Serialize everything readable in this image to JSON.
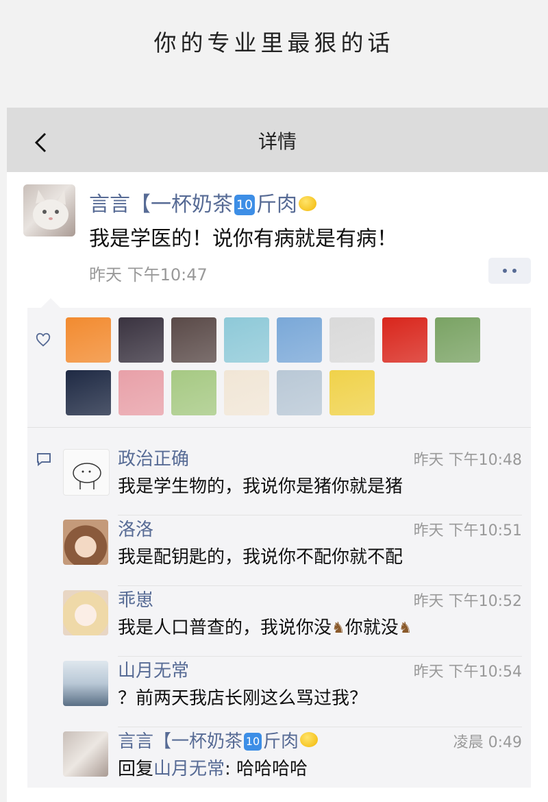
{
  "caption": "你的专业里最狠的话",
  "nav": {
    "title": "详情"
  },
  "post": {
    "author": {
      "name_prefix": "言言【一杯奶茶",
      "badge": "10",
      "name_suffix": "斤肉"
    },
    "text": "我是学医的！说你有病就是有病！",
    "time": "昨天 下午10:47"
  },
  "likes": {
    "avatars": [
      {
        "name": "pumpkin",
        "color": "#f28b30"
      },
      {
        "name": "dark-hair",
        "color": "#3a3340"
      },
      {
        "name": "mask-girl",
        "color": "#5a4a48"
      },
      {
        "name": "blue-hair",
        "color": "#8ec9d8"
      },
      {
        "name": "anime-boy",
        "color": "#7aa8d8"
      },
      {
        "name": "sketch",
        "color": "#d9d9d9"
      },
      {
        "name": "china-flag",
        "color": "#d9261c"
      },
      {
        "name": "anime-girl",
        "color": "#7aa364"
      },
      {
        "name": "suit",
        "color": "#1f2a44"
      },
      {
        "name": "cartoon-pink",
        "color": "#e8a0a8"
      },
      {
        "name": "clover-girl",
        "color": "#a6c983"
      },
      {
        "name": "blonde-anime",
        "color": "#f1e6d6"
      },
      {
        "name": "outdoor-girl",
        "color": "#b9c8d6"
      },
      {
        "name": "yellow-cat",
        "color": "#f0d24a"
      }
    ]
  },
  "comments": [
    {
      "name": "政治正确",
      "time": "昨天 下午10:48",
      "text": "我是学生物的，我说你是猪你就是猪",
      "avatar_color": "#f7f7f7"
    },
    {
      "name": "洛洛",
      "time": "昨天 下午10:51",
      "text": "我是配钥匙的，我说你不配你就不配",
      "avatar_color": "#c49a7a"
    },
    {
      "name": "乖崽",
      "time": "昨天 下午10:52",
      "text_a": "我是人口普查的，我说你没",
      "text_b": "你就没",
      "avatar_color": "#f1e6d6"
    },
    {
      "name": "山月无常",
      "time": "昨天 下午10:54",
      "text": "？前两天我店长刚这么骂过我？",
      "avatar_color": "#b9c8d6"
    },
    {
      "name_prefix": "言言【一杯奶茶",
      "badge": "10",
      "name_suffix": "斤肉",
      "time": "凌晨 0:49",
      "reply_label": "回复",
      "reply_to": "山月无常",
      "reply_text": ": 哈哈哈哈",
      "avatar_color": "#d0c6c0"
    }
  ]
}
